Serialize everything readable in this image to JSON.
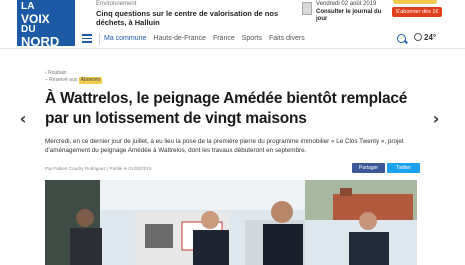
{
  "header": {
    "logo": {
      "line1": "LA",
      "line2": "VOIX",
      "line3": "DU",
      "line4": "NORD"
    },
    "promo": {
      "kicker": "Environnement",
      "text": "Cinq questions sur le centre de valorisation de nos déchets, à Halluin"
    },
    "journal": {
      "date": "Vendredi 02 août 2019",
      "cta": "Consulter le journal du jour"
    },
    "subscribe_label": "S'abonner dès 1€"
  },
  "nav": {
    "items": [
      "Ma commune",
      "Hauts-de-France",
      "France",
      "Sports",
      "Faits divers"
    ],
    "weather": "24°"
  },
  "breadcrumb": {
    "section": "Roubaix",
    "sub": "Réservé aux",
    "tag": "Abonnés"
  },
  "article": {
    "title": "À Wattrelos, le peignage Amédée bientôt remplacé par un lotissement de vingt maisons",
    "lead": "Mercredi, en ce dernier jour de juillet, a eu lieu la pose de la première pierre du programme immobilier « Le Clos Twenty », projet d'aménagement du peignage Amédée à Wattrelos, dont les travaux débuteront en septembre.",
    "byline": "Par Fabien Coudry Rodriguez | Publié le 01/08/2019",
    "share_fb": "Partager",
    "share_tw": "Twitter"
  },
  "colors": {
    "brand": "#1c5aa6",
    "subscribe": "#e2401c",
    "facebook": "#3b5998",
    "twitter": "#1da1f2",
    "tag": "#f2c94c"
  }
}
